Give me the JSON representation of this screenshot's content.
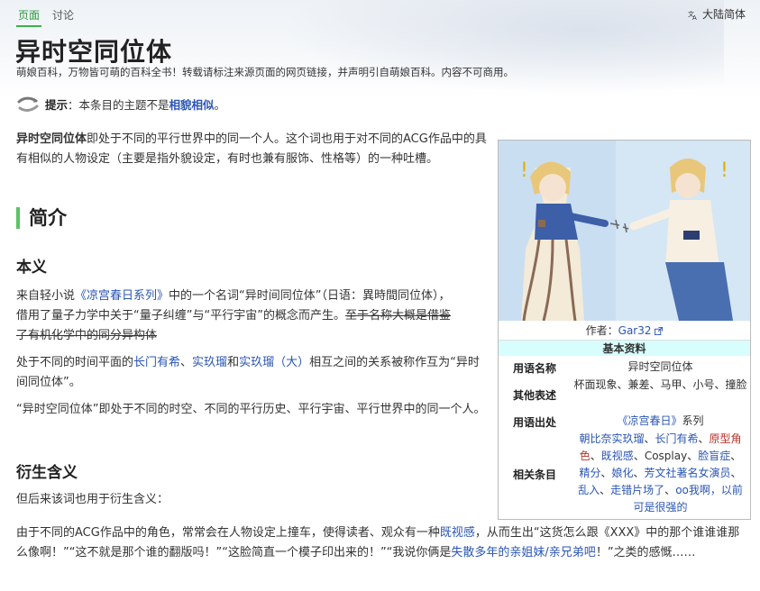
{
  "tabs": [
    {
      "label": "页面"
    },
    {
      "label": "讨论"
    }
  ],
  "language": "大陆简体",
  "page_title": "异时空同位体",
  "site_subtitle": "萌娘百科，万物皆可萌的百科全书！转载请标注来源页面的网页链接，并声明引自萌娘百科。内容不可商用。",
  "notice": {
    "label": "提示",
    "text": "：本条目的主题不是",
    "link": "相貌相似",
    "end": "。"
  },
  "intro": {
    "bold": "异时空同位体",
    "text": "即处于不同的平行世界中的同一个人。这个词也用于对不同的ACG作品中的具有相似的人物设定（主要是指外貌设定，有时也兼有服饰、性格等）的一种吐槽。"
  },
  "h2_intro": "简介",
  "h3_origin": "本义",
  "origin": {
    "p1_a": "来自轻小说",
    "p1_link": "《凉宫春日系列》",
    "p1_b": "中的一个名词“异时间同位体”（日语：異時間同位体），借用了量子力学中关于“量子纠缠”与“平行宇宙”的概念而产生。",
    "p1_strike": "至于名称大概是借鉴了有机化学中的同分异构体",
    "p2_a": "处于不同的时间平面的",
    "p2_l1": "长门有希",
    "p2_sep": "、",
    "p2_l2": "实玖瑠",
    "p2_and": "和",
    "p2_l3": "实玖瑠（大）",
    "p2_b": "相互之间的关系被称作互为“异时间同位体”。",
    "p3": "“异时空同位体”即处于不同的时空、不同的平行历史、平行宇宙、平行世界中的同一个人。"
  },
  "h3_derived": "衍生含义",
  "derived": {
    "p1": "但后来该词也用于衍生含义：",
    "p2_a": "由于不同的ACG作品中的角色，常常会在人物设定上撞车，使得读者、观众有一种",
    "p2_link": "既视感",
    "p2_b": "，从而生出“这货怎么跟《XXX》中的那个谁谁谁那么像啊！”“这不就是那个谁的翻版吗！”“这脸简直一个模子印出来的！”“我说你俩是",
    "p2_link2": "失散多年的亲姐妹/亲兄弟吧",
    "p2_c": "！”之类的感慨……"
  },
  "infobox": {
    "caption_prefix": "作者：",
    "caption_author": "Gar32",
    "header": "基本资料",
    "rows": [
      {
        "key": "用语名称",
        "value": "异时空同位体"
      },
      {
        "key": "其他表述",
        "value": "杯面现象、兼差、马甲、小号、撞脸"
      },
      {
        "key": "用语出处",
        "link": "《凉宫春日》",
        "suffix": "系列"
      },
      {
        "key": "相关条目"
      }
    ],
    "related": {
      "a": "朝比奈实玖瑠",
      "s1": "、",
      "b": "长门有希",
      "s2": "、",
      "c": "原型角色",
      "s3": "、",
      "d": "既视感",
      "s4": "、Cosplay、",
      "e": "脸盲症",
      "s5": "、",
      "f": "精分",
      "s6": "、",
      "g": "娘化",
      "s7": "、",
      "h": "芳文社著名女演员",
      "s8": "、",
      "i": "乱入",
      "s9": "、",
      "j": "走错片场了",
      "s10": "、",
      "k": "oo我啊，以前可是很强的"
    }
  },
  "colors": {
    "accent_green": "#3cb24a",
    "link": "#2a55b5",
    "infobox_header": "#d8fdfd"
  }
}
